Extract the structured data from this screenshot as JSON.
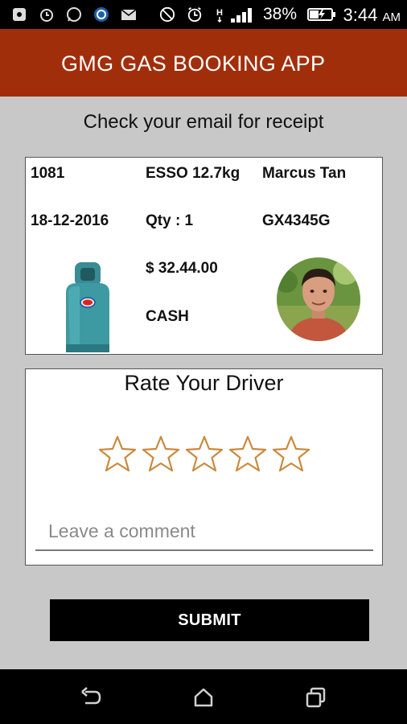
{
  "status_bar": {
    "battery_percent": "38%",
    "time": "3:44",
    "ampm": "AM"
  },
  "app_bar": {
    "title": "GMG GAS BOOKING APP"
  },
  "receipt_message": "Check your email for receipt",
  "order": {
    "id": "1081",
    "product": "ESSO 12.7kg",
    "driver_name": "Marcus Tan",
    "date": "18-12-2016",
    "quantity": "Qty : 1",
    "vehicle": "GX4345G",
    "price": "$ 32.44.00",
    "payment": "CASH"
  },
  "rating": {
    "title": "Rate Your Driver",
    "stars_total": 5,
    "stars_selected": 0,
    "star_color": "#c98a3e",
    "comment_placeholder": "Leave a comment"
  },
  "submit_label": "SUBMIT",
  "colors": {
    "app_bar": "#a12e0b",
    "background": "#c8c8c8",
    "button": "#000000"
  }
}
